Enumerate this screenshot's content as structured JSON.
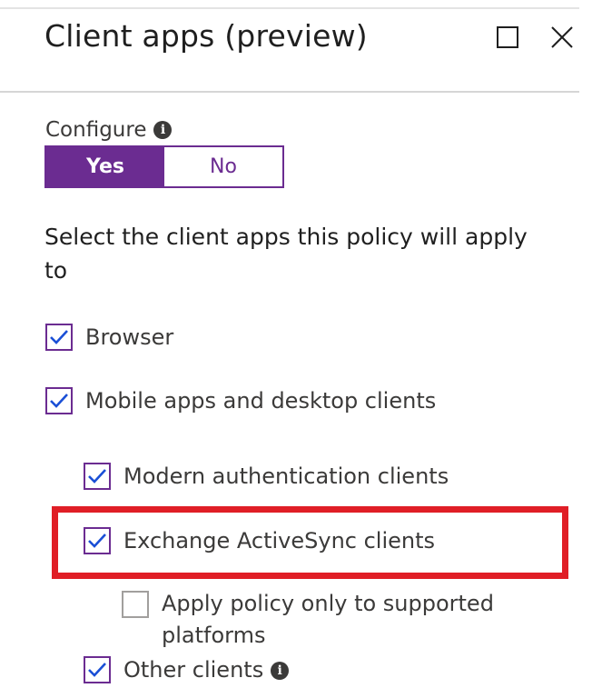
{
  "panel": {
    "title": "Client apps (preview)",
    "maximize_icon": "maximize-icon",
    "close_icon": "close-icon"
  },
  "configure": {
    "label": "Configure",
    "info_icon": "i",
    "options": [
      "Yes",
      "No"
    ],
    "selected": "Yes"
  },
  "description": "Select the client apps this policy will apply to",
  "client_apps": [
    {
      "label": "Browser",
      "checked": true
    },
    {
      "label": "Mobile apps and desktop clients",
      "checked": true
    },
    {
      "label": "Modern authentication clients",
      "checked": true
    },
    {
      "label": "Exchange ActiveSync clients",
      "checked": true,
      "highlighted": true
    },
    {
      "label": "Apply policy only to supported platforms",
      "checked": false
    },
    {
      "label": "Other clients",
      "checked": true,
      "info_icon": "i"
    }
  ],
  "colors": {
    "accent": "#6b2c91",
    "highlight_border": "#e01e26",
    "text": "#323130"
  }
}
